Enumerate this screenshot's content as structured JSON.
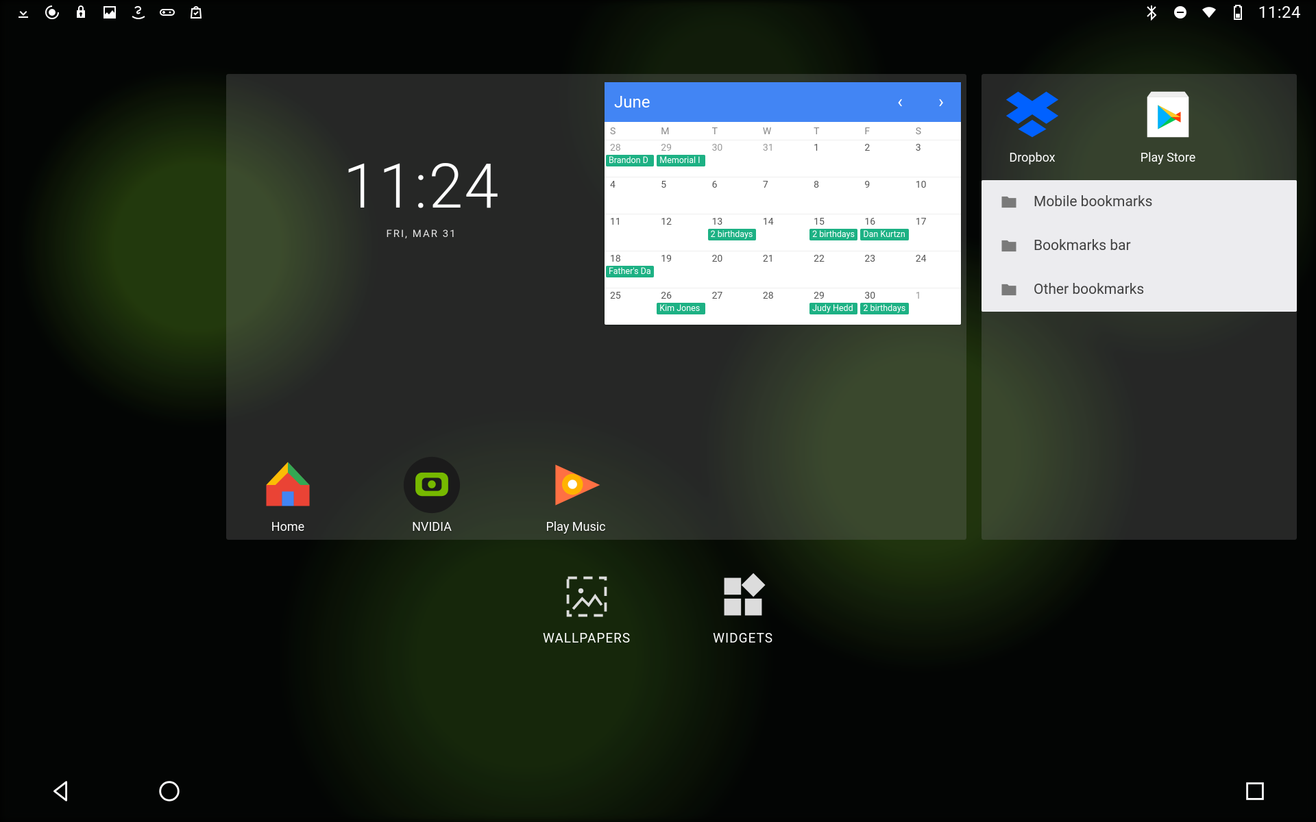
{
  "status": {
    "clock": "11:24",
    "left_icons": [
      "download-icon",
      "nvidia-icon",
      "lock-icon",
      "photo-icon",
      "amazon-icon",
      "gamepad-icon",
      "shopping-bag-icon"
    ],
    "right_icons": [
      "bluetooth-icon",
      "dnd-icon",
      "wifi-icon",
      "battery-icon"
    ]
  },
  "clock_widget": {
    "time": "11:24",
    "date": "FRI, MAR 31"
  },
  "calendar": {
    "month": "June",
    "dow": [
      "S",
      "M",
      "T",
      "W",
      "T",
      "F",
      "S"
    ],
    "weeks": [
      [
        {
          "n": "28",
          "in": false,
          "ev": [
            "Brandon D"
          ]
        },
        {
          "n": "29",
          "in": false,
          "ev": [
            "Memorial I"
          ]
        },
        {
          "n": "30",
          "in": false,
          "ev": []
        },
        {
          "n": "31",
          "in": false,
          "ev": []
        },
        {
          "n": "1",
          "in": true,
          "ev": []
        },
        {
          "n": "2",
          "in": true,
          "ev": []
        },
        {
          "n": "3",
          "in": true,
          "ev": []
        }
      ],
      [
        {
          "n": "4",
          "in": true,
          "ev": []
        },
        {
          "n": "5",
          "in": true,
          "ev": []
        },
        {
          "n": "6",
          "in": true,
          "ev": []
        },
        {
          "n": "7",
          "in": true,
          "ev": []
        },
        {
          "n": "8",
          "in": true,
          "ev": []
        },
        {
          "n": "9",
          "in": true,
          "ev": []
        },
        {
          "n": "10",
          "in": true,
          "ev": []
        }
      ],
      [
        {
          "n": "11",
          "in": true,
          "ev": []
        },
        {
          "n": "12",
          "in": true,
          "ev": []
        },
        {
          "n": "13",
          "in": true,
          "ev": [
            "2 birthdays"
          ]
        },
        {
          "n": "14",
          "in": true,
          "ev": []
        },
        {
          "n": "15",
          "in": true,
          "ev": [
            "2 birthdays"
          ]
        },
        {
          "n": "16",
          "in": true,
          "ev": [
            "Dan Kurtzn"
          ]
        },
        {
          "n": "17",
          "in": true,
          "ev": []
        }
      ],
      [
        {
          "n": "18",
          "in": true,
          "ev": [
            "Father's Da"
          ]
        },
        {
          "n": "19",
          "in": true,
          "ev": []
        },
        {
          "n": "20",
          "in": true,
          "ev": []
        },
        {
          "n": "21",
          "in": true,
          "ev": []
        },
        {
          "n": "22",
          "in": true,
          "ev": []
        },
        {
          "n": "23",
          "in": true,
          "ev": []
        },
        {
          "n": "24",
          "in": true,
          "ev": []
        }
      ],
      [
        {
          "n": "25",
          "in": true,
          "ev": []
        },
        {
          "n": "26",
          "in": true,
          "ev": [
            "Kim Jones"
          ]
        },
        {
          "n": "27",
          "in": true,
          "ev": []
        },
        {
          "n": "28",
          "in": true,
          "ev": []
        },
        {
          "n": "29",
          "in": true,
          "ev": [
            "Judy Hedd"
          ]
        },
        {
          "n": "30",
          "in": true,
          "ev": [
            "2 birthdays"
          ]
        },
        {
          "n": "1",
          "in": false,
          "ev": []
        }
      ]
    ]
  },
  "apps_main": [
    {
      "label": "Home",
      "icon": "google-home-icon"
    },
    {
      "label": "NVIDIA",
      "icon": "nvidia-app-icon"
    },
    {
      "label": "Play Music",
      "icon": "play-music-icon"
    }
  ],
  "apps_side": [
    {
      "label": "Dropbox",
      "icon": "dropbox-icon"
    },
    {
      "label": "Play Store",
      "icon": "play-store-icon"
    }
  ],
  "bookmarks": {
    "items": [
      "Mobile bookmarks",
      "Bookmarks bar",
      "Other bookmarks"
    ]
  },
  "bottom_actions": {
    "wallpapers": "WALLPAPERS",
    "widgets": "WIDGETS"
  }
}
